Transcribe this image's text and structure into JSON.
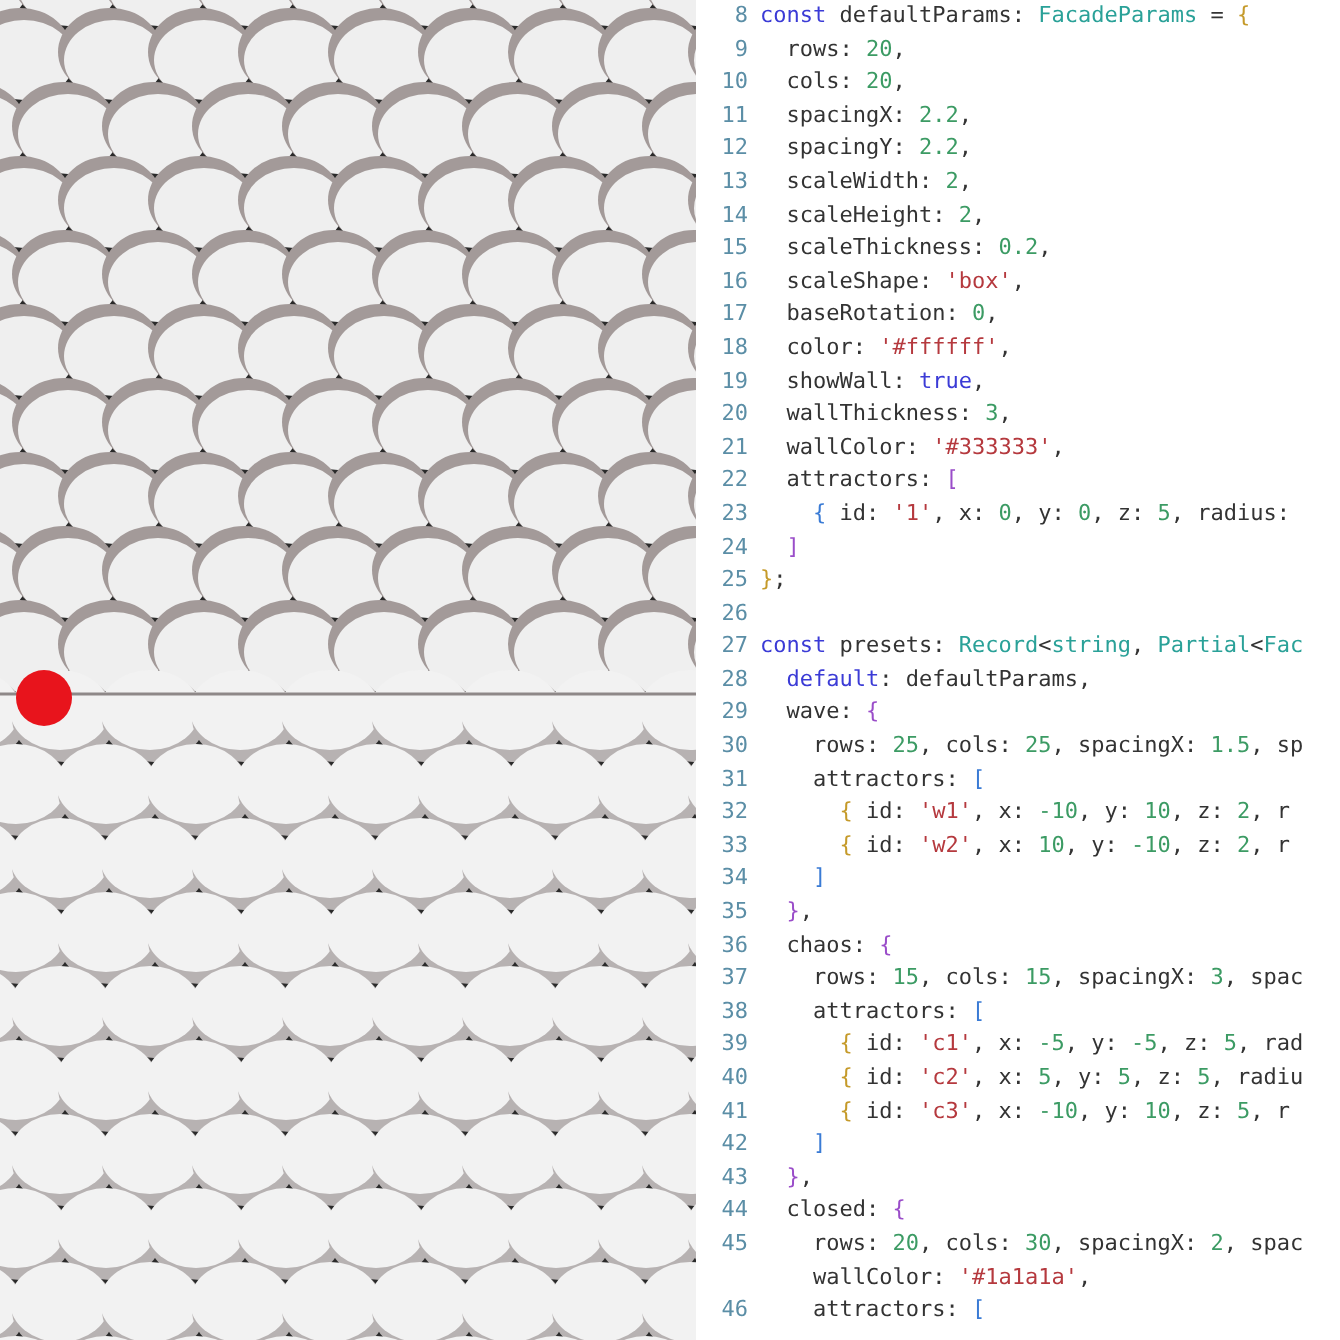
{
  "render": {
    "marker": {
      "color": "#e8141c"
    }
  },
  "editor": {
    "lines": [
      {
        "number": "8",
        "tokens": [
          {
            "kind": "kw",
            "text": "const"
          },
          {
            "kind": "plain",
            "text": " defaultParams: "
          },
          {
            "kind": "type",
            "text": "FacadeParams"
          },
          {
            "kind": "plain",
            "text": " = "
          },
          {
            "kind": "b1",
            "text": "{"
          }
        ]
      },
      {
        "number": "9",
        "tokens": [
          {
            "kind": "plain",
            "text": "  rows: "
          },
          {
            "kind": "num",
            "text": "20"
          },
          {
            "kind": "plain",
            "text": ","
          }
        ]
      },
      {
        "number": "10",
        "tokens": [
          {
            "kind": "plain",
            "text": "  cols: "
          },
          {
            "kind": "num",
            "text": "20"
          },
          {
            "kind": "plain",
            "text": ","
          }
        ]
      },
      {
        "number": "11",
        "tokens": [
          {
            "kind": "plain",
            "text": "  spacingX: "
          },
          {
            "kind": "num",
            "text": "2.2"
          },
          {
            "kind": "plain",
            "text": ","
          }
        ]
      },
      {
        "number": "12",
        "tokens": [
          {
            "kind": "plain",
            "text": "  spacingY: "
          },
          {
            "kind": "num",
            "text": "2.2"
          },
          {
            "kind": "plain",
            "text": ","
          }
        ]
      },
      {
        "number": "13",
        "tokens": [
          {
            "kind": "plain",
            "text": "  scaleWidth: "
          },
          {
            "kind": "num",
            "text": "2"
          },
          {
            "kind": "plain",
            "text": ","
          }
        ]
      },
      {
        "number": "14",
        "tokens": [
          {
            "kind": "plain",
            "text": "  scaleHeight: "
          },
          {
            "kind": "num",
            "text": "2"
          },
          {
            "kind": "plain",
            "text": ","
          }
        ]
      },
      {
        "number": "15",
        "tokens": [
          {
            "kind": "plain",
            "text": "  scaleThickness: "
          },
          {
            "kind": "num",
            "text": "0.2"
          },
          {
            "kind": "plain",
            "text": ","
          }
        ]
      },
      {
        "number": "16",
        "tokens": [
          {
            "kind": "plain",
            "text": "  scaleShape: "
          },
          {
            "kind": "str",
            "text": "'box'"
          },
          {
            "kind": "plain",
            "text": ","
          }
        ]
      },
      {
        "number": "17",
        "tokens": [
          {
            "kind": "plain",
            "text": "  baseRotation: "
          },
          {
            "kind": "num",
            "text": "0"
          },
          {
            "kind": "plain",
            "text": ","
          }
        ]
      },
      {
        "number": "18",
        "tokens": [
          {
            "kind": "plain",
            "text": "  color: "
          },
          {
            "kind": "str",
            "text": "'#ffffff'"
          },
          {
            "kind": "plain",
            "text": ","
          }
        ]
      },
      {
        "number": "19",
        "tokens": [
          {
            "kind": "plain",
            "text": "  showWall: "
          },
          {
            "kind": "kw",
            "text": "true"
          },
          {
            "kind": "plain",
            "text": ","
          }
        ]
      },
      {
        "number": "20",
        "tokens": [
          {
            "kind": "plain",
            "text": "  wallThickness: "
          },
          {
            "kind": "num",
            "text": "3"
          },
          {
            "kind": "plain",
            "text": ","
          }
        ]
      },
      {
        "number": "21",
        "tokens": [
          {
            "kind": "plain",
            "text": "  wallColor: "
          },
          {
            "kind": "str",
            "text": "'#333333'"
          },
          {
            "kind": "plain",
            "text": ","
          }
        ]
      },
      {
        "number": "22",
        "tokens": [
          {
            "kind": "plain",
            "text": "  attractors: "
          },
          {
            "kind": "b2",
            "text": "["
          }
        ]
      },
      {
        "number": "23",
        "tokens": [
          {
            "kind": "b3",
            "text": "    {"
          },
          {
            "kind": "plain",
            "text": " id: "
          },
          {
            "kind": "str",
            "text": "'1'"
          },
          {
            "kind": "plain",
            "text": ", x: "
          },
          {
            "kind": "num",
            "text": "0"
          },
          {
            "kind": "plain",
            "text": ", y: "
          },
          {
            "kind": "num",
            "text": "0"
          },
          {
            "kind": "plain",
            "text": ", z: "
          },
          {
            "kind": "num",
            "text": "5"
          },
          {
            "kind": "plain",
            "text": ", radius:"
          }
        ]
      },
      {
        "number": "24",
        "tokens": [
          {
            "kind": "b2",
            "text": "  ]"
          }
        ]
      },
      {
        "number": "25",
        "tokens": [
          {
            "kind": "b1",
            "text": "}"
          },
          {
            "kind": "plain",
            "text": ";"
          }
        ]
      },
      {
        "number": "26"
      },
      {
        "number": "27",
        "tokens": [
          {
            "kind": "kw",
            "text": "const"
          },
          {
            "kind": "plain",
            "text": " presets: "
          },
          {
            "kind": "type",
            "text": "Record"
          },
          {
            "kind": "plain",
            "text": "<"
          },
          {
            "kind": "type",
            "text": "string"
          },
          {
            "kind": "plain",
            "text": ", "
          },
          {
            "kind": "type",
            "text": "Partial"
          },
          {
            "kind": "plain",
            "text": "<"
          },
          {
            "kind": "type",
            "text": "Fac"
          }
        ]
      },
      {
        "number": "28",
        "tokens": [
          {
            "kind": "kw",
            "text": "  default"
          },
          {
            "kind": "plain",
            "text": ": defaultParams,"
          }
        ]
      },
      {
        "number": "29",
        "tokens": [
          {
            "kind": "plain",
            "text": "  wave: "
          },
          {
            "kind": "b2",
            "text": "{"
          }
        ]
      },
      {
        "number": "30",
        "tokens": [
          {
            "kind": "plain",
            "text": "    rows: "
          },
          {
            "kind": "num",
            "text": "25"
          },
          {
            "kind": "plain",
            "text": ", cols: "
          },
          {
            "kind": "num",
            "text": "25"
          },
          {
            "kind": "plain",
            "text": ", spacingX: "
          },
          {
            "kind": "num",
            "text": "1.5"
          },
          {
            "kind": "plain",
            "text": ", sp"
          }
        ]
      },
      {
        "number": "31",
        "tokens": [
          {
            "kind": "plain",
            "text": "    attractors: "
          },
          {
            "kind": "b3",
            "text": "["
          }
        ]
      },
      {
        "number": "32",
        "tokens": [
          {
            "kind": "b1",
            "text": "      {"
          },
          {
            "kind": "plain",
            "text": " id: "
          },
          {
            "kind": "str",
            "text": "'w1'"
          },
          {
            "kind": "plain",
            "text": ", x: "
          },
          {
            "kind": "num",
            "text": "-10"
          },
          {
            "kind": "plain",
            "text": ", y: "
          },
          {
            "kind": "num",
            "text": "10"
          },
          {
            "kind": "plain",
            "text": ", z: "
          },
          {
            "kind": "num",
            "text": "2"
          },
          {
            "kind": "plain",
            "text": ", r"
          }
        ]
      },
      {
        "number": "33",
        "tokens": [
          {
            "kind": "b1",
            "text": "      {"
          },
          {
            "kind": "plain",
            "text": " id: "
          },
          {
            "kind": "str",
            "text": "'w2'"
          },
          {
            "kind": "plain",
            "text": ", x: "
          },
          {
            "kind": "num",
            "text": "10"
          },
          {
            "kind": "plain",
            "text": ", y: "
          },
          {
            "kind": "num",
            "text": "-10"
          },
          {
            "kind": "plain",
            "text": ", z: "
          },
          {
            "kind": "num",
            "text": "2"
          },
          {
            "kind": "plain",
            "text": ", r"
          }
        ]
      },
      {
        "number": "34",
        "tokens": [
          {
            "kind": "b3",
            "text": "    ]"
          }
        ]
      },
      {
        "number": "35",
        "tokens": [
          {
            "kind": "b2",
            "text": "  }"
          },
          {
            "kind": "plain",
            "text": ","
          }
        ]
      },
      {
        "number": "36",
        "tokens": [
          {
            "kind": "plain",
            "text": "  chaos: "
          },
          {
            "kind": "b2",
            "text": "{"
          }
        ]
      },
      {
        "number": "37",
        "tokens": [
          {
            "kind": "plain",
            "text": "    rows: "
          },
          {
            "kind": "num",
            "text": "15"
          },
          {
            "kind": "plain",
            "text": ", cols: "
          },
          {
            "kind": "num",
            "text": "15"
          },
          {
            "kind": "plain",
            "text": ", spacingX: "
          },
          {
            "kind": "num",
            "text": "3"
          },
          {
            "kind": "plain",
            "text": ", spac"
          }
        ]
      },
      {
        "number": "38",
        "tokens": [
          {
            "kind": "plain",
            "text": "    attractors: "
          },
          {
            "kind": "b3",
            "text": "["
          }
        ]
      },
      {
        "number": "39",
        "tokens": [
          {
            "kind": "b1",
            "text": "      {"
          },
          {
            "kind": "plain",
            "text": " id: "
          },
          {
            "kind": "str",
            "text": "'c1'"
          },
          {
            "kind": "plain",
            "text": ", x: "
          },
          {
            "kind": "num",
            "text": "-5"
          },
          {
            "kind": "plain",
            "text": ", y: "
          },
          {
            "kind": "num",
            "text": "-5"
          },
          {
            "kind": "plain",
            "text": ", z: "
          },
          {
            "kind": "num",
            "text": "5"
          },
          {
            "kind": "plain",
            "text": ", rad"
          }
        ]
      },
      {
        "number": "40",
        "tokens": [
          {
            "kind": "b1",
            "text": "      {"
          },
          {
            "kind": "plain",
            "text": " id: "
          },
          {
            "kind": "str",
            "text": "'c2'"
          },
          {
            "kind": "plain",
            "text": ", x: "
          },
          {
            "kind": "num",
            "text": "5"
          },
          {
            "kind": "plain",
            "text": ", y: "
          },
          {
            "kind": "num",
            "text": "5"
          },
          {
            "kind": "plain",
            "text": ", z: "
          },
          {
            "kind": "num",
            "text": "5"
          },
          {
            "kind": "plain",
            "text": ", radiu"
          }
        ]
      },
      {
        "number": "41",
        "tokens": [
          {
            "kind": "b1",
            "text": "      {"
          },
          {
            "kind": "plain",
            "text": " id: "
          },
          {
            "kind": "str",
            "text": "'c3'"
          },
          {
            "kind": "plain",
            "text": ", x: "
          },
          {
            "kind": "num",
            "text": "-10"
          },
          {
            "kind": "plain",
            "text": ", y: "
          },
          {
            "kind": "num",
            "text": "10"
          },
          {
            "kind": "plain",
            "text": ", z: "
          },
          {
            "kind": "num",
            "text": "5"
          },
          {
            "kind": "plain",
            "text": ", r"
          }
        ]
      },
      {
        "number": "42",
        "tokens": [
          {
            "kind": "b3",
            "text": "    ]"
          }
        ]
      },
      {
        "number": "43",
        "tokens": [
          {
            "kind": "b2",
            "text": "  }"
          },
          {
            "kind": "plain",
            "text": ","
          }
        ]
      },
      {
        "number": "44",
        "tokens": [
          {
            "kind": "plain",
            "text": "  closed: "
          },
          {
            "kind": "b2",
            "text": "{"
          }
        ]
      },
      {
        "number": "45",
        "tokens": [
          {
            "kind": "plain",
            "text": "    rows: "
          },
          {
            "kind": "num",
            "text": "20"
          },
          {
            "kind": "plain",
            "text": ", cols: "
          },
          {
            "kind": "num",
            "text": "30"
          },
          {
            "kind": "plain",
            "text": ", spacingX: "
          },
          {
            "kind": "num",
            "text": "2"
          },
          {
            "kind": "plain",
            "text": ", spac"
          }
        ]
      },
      {
        "tokens": [
          {
            "kind": "plain",
            "text": "    wallColor: "
          },
          {
            "kind": "str",
            "text": "'#1a1a1a'"
          },
          {
            "kind": "plain",
            "text": ","
          }
        ]
      },
      {
        "number": "46",
        "tokens": [
          {
            "kind": "plain",
            "text": "    attractors: "
          },
          {
            "kind": "b3",
            "text": "["
          }
        ]
      }
    ]
  }
}
